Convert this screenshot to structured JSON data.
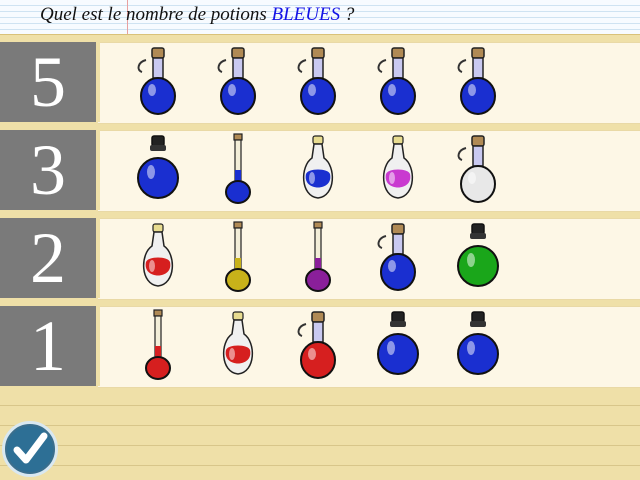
{
  "question": {
    "prefix": "Quel est le nombre de potions ",
    "highlight": "BLEUES",
    "suffix": " ?"
  },
  "rows": [
    {
      "answer": "5",
      "potions": [
        "blue-flask",
        "blue-flask",
        "blue-flask",
        "blue-flask",
        "blue-flask"
      ]
    },
    {
      "answer": "3",
      "potions": [
        "blue-round",
        "blue-tube",
        "blue-pear",
        "magenta-pear",
        "white-flask"
      ]
    },
    {
      "answer": "2",
      "potions": [
        "red-pear",
        "yellow-tube",
        "purple-tube",
        "blue-flask",
        "green-round"
      ]
    },
    {
      "answer": "1",
      "potions": [
        "red-tube",
        "red-pear",
        "red-flask",
        "blue-round",
        "blue-round"
      ]
    }
  ],
  "colors": {
    "blue": "#1a2fd0",
    "red": "#d61f1f",
    "yellow": "#c8b21a",
    "purple": "#8a1f9a",
    "magenta": "#c93ad0",
    "green": "#1aa61a",
    "white": "#e8e8e8",
    "number_tile": "#7a7a7a",
    "highlight_text": "#1313e6"
  },
  "icons": {
    "validate": "checkmark-icon"
  }
}
